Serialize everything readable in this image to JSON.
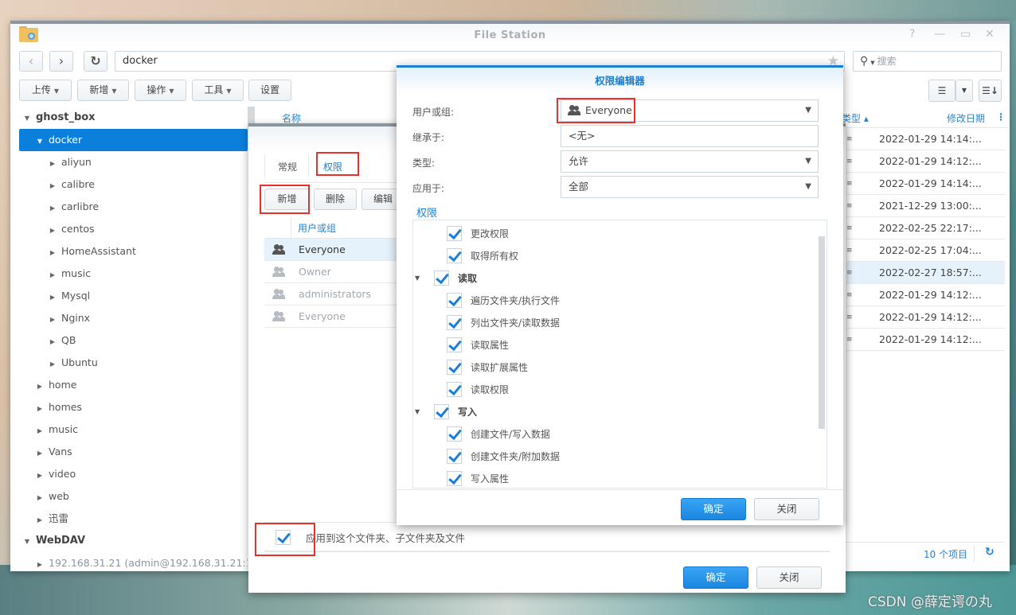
{
  "window": {
    "title": "File Station",
    "controls": [
      "help-icon",
      "minimize-icon",
      "maximize-icon",
      "close-icon"
    ]
  },
  "toolbar": {
    "back_icon": "‹",
    "forward_icon": "›",
    "refresh_icon": "↻",
    "path": "docker",
    "search_placeholder": "搜索",
    "buttons": [
      {
        "label": "上传",
        "dropdown": true
      },
      {
        "label": "新增",
        "dropdown": true
      },
      {
        "label": "操作",
        "dropdown": true
      },
      {
        "label": "工具",
        "dropdown": true
      },
      {
        "label": "设置",
        "dropdown": false
      }
    ]
  },
  "tree": {
    "items": [
      {
        "label": "ghost_box",
        "level": 0,
        "expanded": true,
        "root": true
      },
      {
        "label": "docker",
        "level": 1,
        "expanded": true,
        "selected": true
      },
      {
        "label": "aliyun",
        "level": 2
      },
      {
        "label": "calibre",
        "level": 2
      },
      {
        "label": "carlibre",
        "level": 2
      },
      {
        "label": "centos",
        "level": 2
      },
      {
        "label": "HomeAssistant",
        "level": 2
      },
      {
        "label": "music",
        "level": 2
      },
      {
        "label": "Mysql",
        "level": 2
      },
      {
        "label": "Nginx",
        "level": 2
      },
      {
        "label": "QB",
        "level": 2
      },
      {
        "label": "Ubuntu",
        "level": 2
      },
      {
        "label": "home",
        "level": 1
      },
      {
        "label": "homes",
        "level": 1
      },
      {
        "label": "music",
        "level": 1
      },
      {
        "label": "Vans",
        "level": 1
      },
      {
        "label": "video",
        "level": 1
      },
      {
        "label": "web",
        "level": 1
      },
      {
        "label": "迅雷",
        "level": 1
      },
      {
        "label": "WebDAV",
        "level": 0,
        "expanded": true,
        "root": true
      },
      {
        "label": "192.168.31.21 (admin@192.168.31.21:1",
        "level": 1,
        "dim": true
      }
    ]
  },
  "grid": {
    "columns": {
      "name": "名称",
      "type": "类型 ▴",
      "modified": "修改日期"
    },
    "dates": [
      "2022-01-29 14:14:...",
      "2022-01-29 14:12:...",
      "2022-01-29 14:14:...",
      "2021-12-29 13:00:...",
      "2022-02-25 22:17:...",
      "2022-02-25 17:04:...",
      "2022-02-27 18:57:...",
      "2022-01-29 14:12:...",
      "2022-01-29 14:12:...",
      "2022-01-29 14:12:..."
    ],
    "highlighted_row": 6,
    "item_count": "10 个项目"
  },
  "properties_dialog": {
    "tabs": [
      {
        "label": "常规",
        "active": false
      },
      {
        "label": "权限",
        "active": true
      }
    ],
    "buttons": {
      "add": "新增",
      "delete": "删除",
      "edit": "编辑"
    },
    "list_header": "用户或组",
    "entries": [
      {
        "name": "Everyone",
        "dim": false,
        "selected": true
      },
      {
        "name": "Owner",
        "dim": true
      },
      {
        "name": "administrators",
        "dim": true
      },
      {
        "name": "Everyone",
        "dim": true
      }
    ],
    "apply_label": "应用到这个文件夹、子文件夹及文件",
    "apply_checked": true,
    "ok": "确定",
    "close": "关闭"
  },
  "permission_editor": {
    "title": "权限编辑器",
    "fields": {
      "user_label": "用户或组:",
      "user_value": "Everyone",
      "inherit_label": "继承于:",
      "inherit_value": "<无>",
      "type_label": "类型:",
      "type_value": "允许",
      "apply_label": "应用于:",
      "apply_value": "全部"
    },
    "section_title": "权限",
    "permissions": [
      {
        "label": "更改权限",
        "checked": true,
        "group": false
      },
      {
        "label": "取得所有权",
        "checked": true,
        "group": false
      },
      {
        "label": "读取",
        "checked": true,
        "group": true
      },
      {
        "label": "遍历文件夹/执行文件",
        "checked": true,
        "group": false
      },
      {
        "label": "列出文件夹/读取数据",
        "checked": true,
        "group": false
      },
      {
        "label": "读取属性",
        "checked": true,
        "group": false
      },
      {
        "label": "读取扩展属性",
        "checked": true,
        "group": false
      },
      {
        "label": "读取权限",
        "checked": true,
        "group": false
      },
      {
        "label": "写入",
        "checked": true,
        "group": true
      },
      {
        "label": "创建文件/写入数据",
        "checked": true,
        "group": false
      },
      {
        "label": "创建文件夹/附加数据",
        "checked": true,
        "group": false
      },
      {
        "label": "写入属性",
        "checked": true,
        "group": false
      }
    ],
    "ok": "确定",
    "close": "关闭"
  },
  "watermark": "CSDN @薛定谔の丸"
}
